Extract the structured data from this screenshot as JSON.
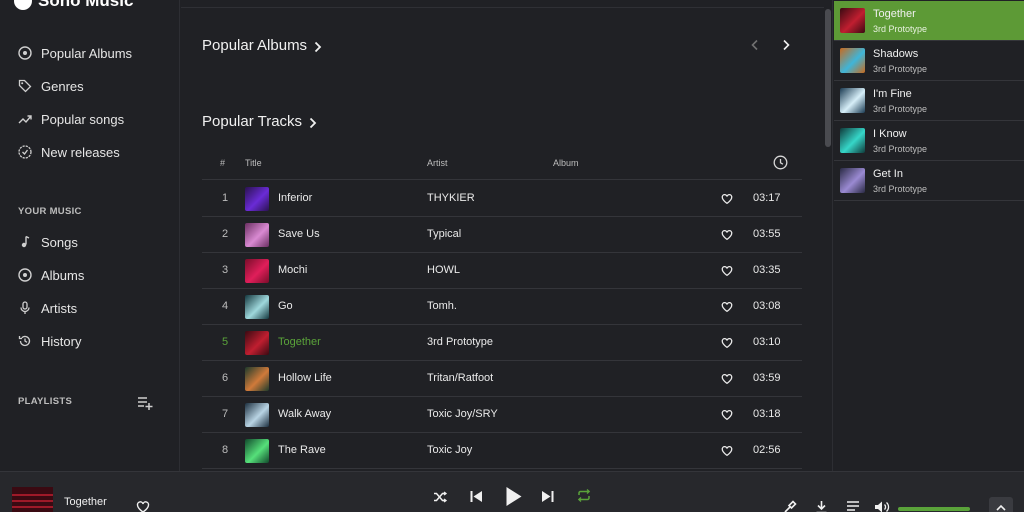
{
  "app": {
    "name": "Sono Music"
  },
  "sidebar": {
    "nav": [
      {
        "label": "Popular Albums",
        "icon": "album-icon"
      },
      {
        "label": "Genres",
        "icon": "tag-icon"
      },
      {
        "label": "Popular songs",
        "icon": "trending-icon"
      },
      {
        "label": "New releases",
        "icon": "new-releases-icon"
      }
    ],
    "your_music_heading": "YOUR MUSIC",
    "your_music": [
      {
        "label": "Songs",
        "icon": "music-note-icon"
      },
      {
        "label": "Albums",
        "icon": "album-icon"
      },
      {
        "label": "Artists",
        "icon": "microphone-icon"
      },
      {
        "label": "History",
        "icon": "history-icon"
      }
    ],
    "playlists_heading": "PLAYLISTS"
  },
  "main": {
    "popular_albums_heading": "Popular Albums",
    "popular_tracks_heading": "Popular Tracks",
    "table_headers": {
      "num": "#",
      "title": "Title",
      "artist": "Artist",
      "album": "Album"
    },
    "tracks": [
      {
        "num": "1",
        "title": "Inferior",
        "artist": "THYKIER",
        "duration": "03:17",
        "thumb": [
          "#2a1250",
          "#6a2bd6"
        ]
      },
      {
        "num": "2",
        "title": "Save Us",
        "artist": "Typical",
        "duration": "03:55",
        "thumb": [
          "#6b2f62",
          "#d98ad2"
        ]
      },
      {
        "num": "3",
        "title": "Mochi",
        "artist": "HOWL",
        "duration": "03:35",
        "thumb": [
          "#7a0d2a",
          "#e01e5a"
        ]
      },
      {
        "num": "4",
        "title": "Go",
        "artist": "Tomh.",
        "duration": "03:08",
        "thumb": [
          "#14383f",
          "#9fd8dc"
        ]
      },
      {
        "num": "5",
        "title": "Together",
        "artist": "3rd Prototype",
        "duration": "03:10",
        "thumb": [
          "#3a0a12",
          "#c01e30"
        ],
        "playing": true
      },
      {
        "num": "6",
        "title": "Hollow Life",
        "artist": "Tritan/Ratfoot",
        "duration": "03:59",
        "thumb": [
          "#1d3a2c",
          "#d07a3a"
        ]
      },
      {
        "num": "7",
        "title": "Walk Away",
        "artist": "Toxic Joy/SRY",
        "duration": "03:18",
        "thumb": [
          "#1c2f3f",
          "#b9d4e4"
        ]
      },
      {
        "num": "8",
        "title": "The Rave",
        "artist": "Toxic Joy",
        "duration": "02:56",
        "thumb": [
          "#114a2c",
          "#56e07a"
        ]
      }
    ]
  },
  "queue": [
    {
      "title": "Together",
      "artist": "3rd Prototype",
      "thumb": [
        "#3a0a12",
        "#c01e30"
      ],
      "active": true
    },
    {
      "title": "Shadows",
      "artist": "3rd Prototype",
      "thumb": [
        "#c86a1e",
        "#3fb5d8"
      ]
    },
    {
      "title": "I'm Fine",
      "artist": "3rd Prototype",
      "thumb": [
        "#1a3a52",
        "#d6eef8"
      ]
    },
    {
      "title": "I Know",
      "artist": "3rd Prototype",
      "thumb": [
        "#0f3a3a",
        "#36d6c8"
      ]
    },
    {
      "title": "Get In",
      "artist": "3rd Prototype",
      "thumb": [
        "#2a2a44",
        "#9a8ad2"
      ]
    }
  ],
  "player": {
    "title": "Together",
    "volume_percent": 100
  },
  "colors": {
    "accent": "#5aa33a",
    "bg": "#202125",
    "player_bg": "#27282c"
  }
}
